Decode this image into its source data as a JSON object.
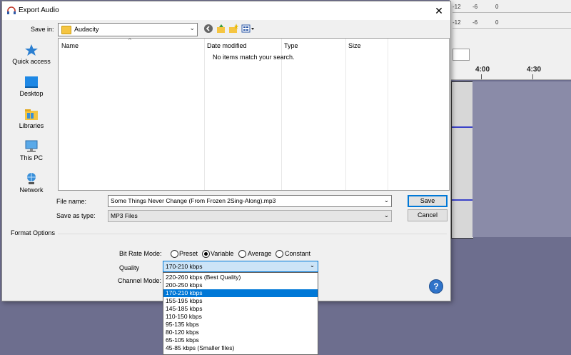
{
  "dialog": {
    "title": "Export Audio",
    "close_label": "✕"
  },
  "save_in": {
    "label": "Save in:",
    "value": "Audacity"
  },
  "places": [
    {
      "label": "Quick access",
      "icon": "star-icon"
    },
    {
      "label": "Desktop",
      "icon": "desktop-icon"
    },
    {
      "label": "Libraries",
      "icon": "libraries-icon"
    },
    {
      "label": "This PC",
      "icon": "computer-icon"
    },
    {
      "label": "Network",
      "icon": "network-icon"
    }
  ],
  "file_list": {
    "columns": [
      "Name",
      "Date modified",
      "Type",
      "Size"
    ],
    "empty_message": "No items match your search."
  },
  "file_name": {
    "label": "File name:",
    "value": "Some Things Never Change (From Frozen 2Sing-Along).mp3"
  },
  "save_as_type": {
    "label": "Save as type:",
    "value": "MP3 Files"
  },
  "buttons": {
    "save": "Save",
    "cancel": "Cancel"
  },
  "format_options": {
    "label": "Format Options",
    "bit_rate_mode_label": "Bit Rate Mode:",
    "modes": [
      "Preset",
      "Variable",
      "Average",
      "Constant"
    ],
    "selected_mode": "Variable",
    "quality_label": "Quality",
    "quality_value": "170-210 kbps",
    "channel_mode_label": "Channel Mode:",
    "quality_options": [
      "220-260 kbps (Best Quality)",
      "200-250 kbps",
      "170-210 kbps",
      "155-195 kbps",
      "145-185 kbps",
      "110-150 kbps",
      "95-135 kbps",
      "80-120 kbps",
      "65-105 kbps",
      "45-85 kbps (Smaller files)"
    ],
    "selected_quality_index": 2,
    "help_label": "?"
  },
  "audacity": {
    "meter_labels": [
      "-12",
      "-6",
      "0",
      "-12",
      "-6",
      "0"
    ],
    "timeline": [
      "4:00",
      "4:30"
    ]
  },
  "colors": {
    "accent": "#0078d7",
    "background": "#6d6e8e",
    "waveform": "#3b42c8"
  }
}
